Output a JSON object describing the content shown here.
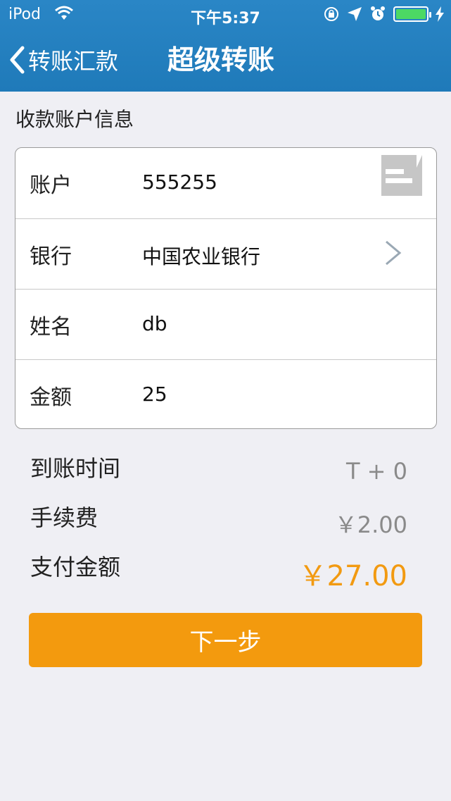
{
  "status_bar": {
    "carrier": "iPod",
    "time": "下午5:37",
    "icons": [
      "wifi-icon",
      "rotation-lock-icon",
      "location-icon",
      "alarm-icon",
      "battery-icon"
    ]
  },
  "nav": {
    "back_label": "转账汇款",
    "title": "超级转账",
    "bar_color": "#2a86c6"
  },
  "section_title": "收款账户信息",
  "form": {
    "rows": [
      {
        "label": "账户",
        "value": "555255",
        "icon": "card-scan-icon"
      },
      {
        "label": "银行",
        "value": "中国农业银行",
        "icon": "chevron-right-icon"
      },
      {
        "label": "姓名",
        "value": "db"
      },
      {
        "label": "金额",
        "value": "25"
      }
    ]
  },
  "summary": {
    "arrival_label": "到账时间",
    "arrival_value": "T + 0",
    "fee_label": "手续费",
    "fee_value": "￥2.00",
    "total_label": "支付金额",
    "total_value": "￥27.00"
  },
  "next_button": {
    "label": "下一步",
    "color": "#f39a0e"
  },
  "colors": {
    "accent": "#f29a11",
    "muted": "#8a8a8a"
  }
}
